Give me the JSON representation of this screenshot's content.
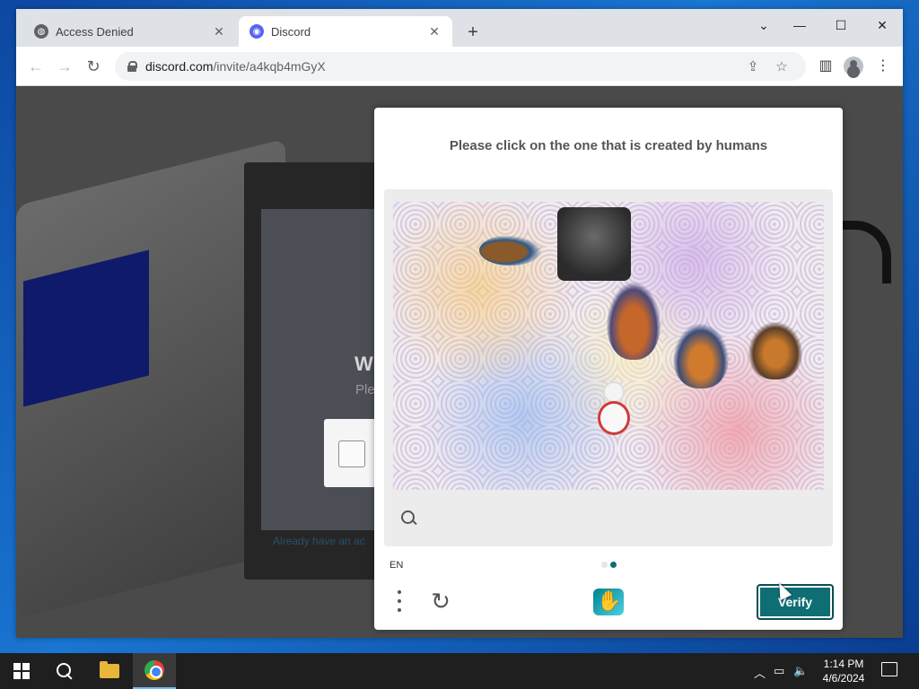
{
  "browser": {
    "tabs": [
      {
        "title": "Access Denied",
        "icon": "globe-icon",
        "active": false
      },
      {
        "title": "Discord",
        "icon": "discord-icon",
        "active": true
      }
    ],
    "new_tab": "+",
    "window_controls": {
      "dropdown": "⌄",
      "minimize": "—",
      "maximize": "☐",
      "close": "✕"
    },
    "url_domain": "discord.com",
    "url_path": "/invite/a4kqb4mGyX"
  },
  "background_page": {
    "welcome": "W",
    "please": "Ple",
    "already": "Already have an ac"
  },
  "captcha": {
    "prompt": "Please click on the one that is created by humans",
    "language": "EN",
    "verify_label": "Verify",
    "brand_color": "#0f6e73"
  },
  "taskbar": {
    "time": "1:14 PM",
    "date": "4/6/2024"
  }
}
